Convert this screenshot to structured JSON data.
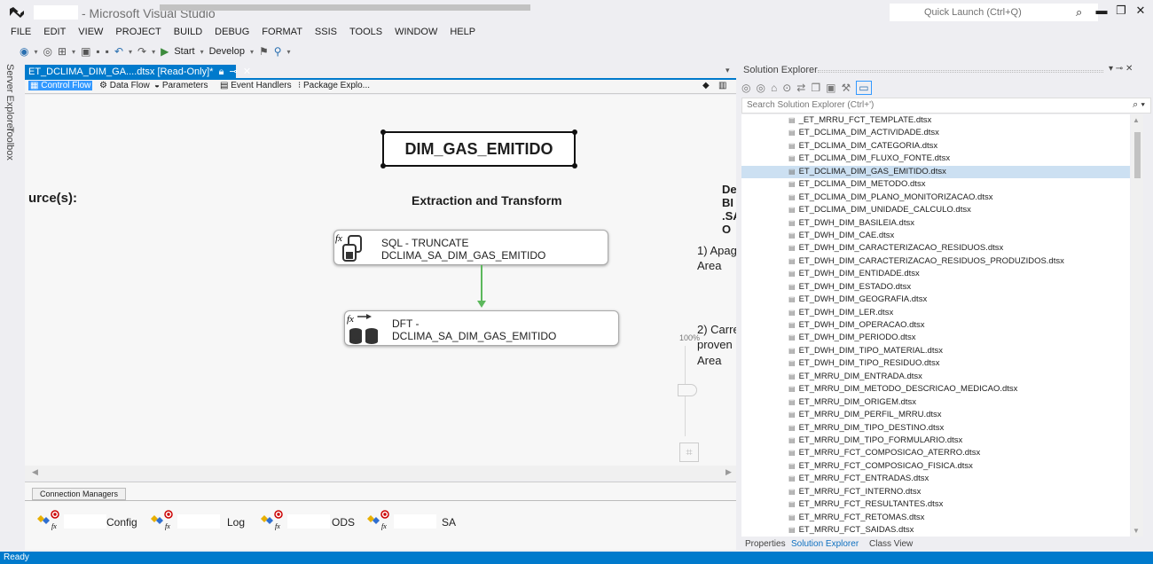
{
  "window": {
    "title": "- Microsoft Visual Studio",
    "quick_launch": "Quick Launch (Ctrl+Q)"
  },
  "menu": [
    "FILE",
    "EDIT",
    "VIEW",
    "PROJECT",
    "BUILD",
    "DEBUG",
    "FORMAT",
    "SSIS",
    "TOOLS",
    "WINDOW",
    "HELP"
  ],
  "toolbar": {
    "start_label": "Start",
    "config_label": "Develop"
  },
  "side_tabs": {
    "server_explorer": "Server Explorer",
    "toolbox": "Toolbox"
  },
  "document_tab": {
    "label": "ET_DCLIMA_DIM_GA....dtsx [Read-Only]*"
  },
  "designer_tabs": [
    "Control Flow",
    "Data Flow",
    "Parameters",
    "Event Handlers",
    "Package Explo..."
  ],
  "canvas": {
    "package_title": "DIM_GAS_EMITIDO",
    "sources_label": "urce(s):",
    "extraction_label": "Extraction and Transform",
    "task1": {
      "line1": "SQL - TRUNCATE",
      "line2": "DCLIMA_SA_DIM_GAS_EMITIDO"
    },
    "task2": {
      "line1": "DFT -",
      "line2": "DCLIMA_SA_DIM_GAS_EMITIDO"
    },
    "right_bold": [
      "De",
      "BI",
      ".SA",
      "O"
    ],
    "right_text": [
      "1) Apag",
      "Area",
      "2) Carre",
      "proven",
      "Area"
    ],
    "zoom": "100%"
  },
  "connection_managers": {
    "tab_label": "Connection Managers",
    "items": [
      "Config",
      "Log",
      "ODS",
      "SA"
    ]
  },
  "solution_explorer": {
    "title": "Solution Explorer",
    "search_placeholder": "Search Solution Explorer (Ctrl+')",
    "selected_index": 4,
    "files": [
      "_ET_MRRU_FCT_TEMPLATE.dtsx",
      "ET_DCLIMA_DIM_ACTIVIDADE.dtsx",
      "ET_DCLIMA_DIM_CATEGORIA.dtsx",
      "ET_DCLIMA_DIM_FLUXO_FONTE.dtsx",
      "ET_DCLIMA_DIM_GAS_EMITIDO.dtsx",
      "ET_DCLIMA_DIM_METODO.dtsx",
      "ET_DCLIMA_DIM_PLANO_MONITORIZACAO.dtsx",
      "ET_DCLIMA_DIM_UNIDADE_CALCULO.dtsx",
      "ET_DWH_DIM_BASILEIA.dtsx",
      "ET_DWH_DIM_CAE.dtsx",
      "ET_DWH_DIM_CARACTERIZACAO_RESIDUOS.dtsx",
      "ET_DWH_DIM_CARACTERIZACAO_RESIDUOS_PRODUZIDOS.dtsx",
      "ET_DWH_DIM_ENTIDADE.dtsx",
      "ET_DWH_DIM_ESTADO.dtsx",
      "ET_DWH_DIM_GEOGRAFIA.dtsx",
      "ET_DWH_DIM_LER.dtsx",
      "ET_DWH_DIM_OPERACAO.dtsx",
      "ET_DWH_DIM_PERIODO.dtsx",
      "ET_DWH_DIM_TIPO_MATERIAL.dtsx",
      "ET_DWH_DIM_TIPO_RESIDUO.dtsx",
      "ET_MRRU_DIM_ENTRADA.dtsx",
      "ET_MRRU_DIM_METODO_DESCRICAO_MEDICAO.dtsx",
      "ET_MRRU_DIM_ORIGEM.dtsx",
      "ET_MRRU_DIM_PERFIL_MRRU.dtsx",
      "ET_MRRU_DIM_TIPO_DESTINO.dtsx",
      "ET_MRRU_DIM_TIPO_FORMULARIO.dtsx",
      "ET_MRRU_FCT_COMPOSICAO_ATERRO.dtsx",
      "ET_MRRU_FCT_COMPOSICAO_FISICA.dtsx",
      "ET_MRRU_FCT_ENTRADAS.dtsx",
      "ET_MRRU_FCT_INTERNO.dtsx",
      "ET_MRRU_FCT_RESULTANTES.dtsx",
      "ET_MRRU_FCT_RETOMAS.dtsx",
      "ET_MRRU_FCT_SAIDAS.dtsx"
    ],
    "bottom_tabs": [
      "Properties",
      "Solution Explorer",
      "Class View"
    ]
  },
  "status": "Ready",
  "colors": {
    "accent": "#007acc",
    "selection": "#cce0f2",
    "flow_arrow": "#5cb85c"
  }
}
